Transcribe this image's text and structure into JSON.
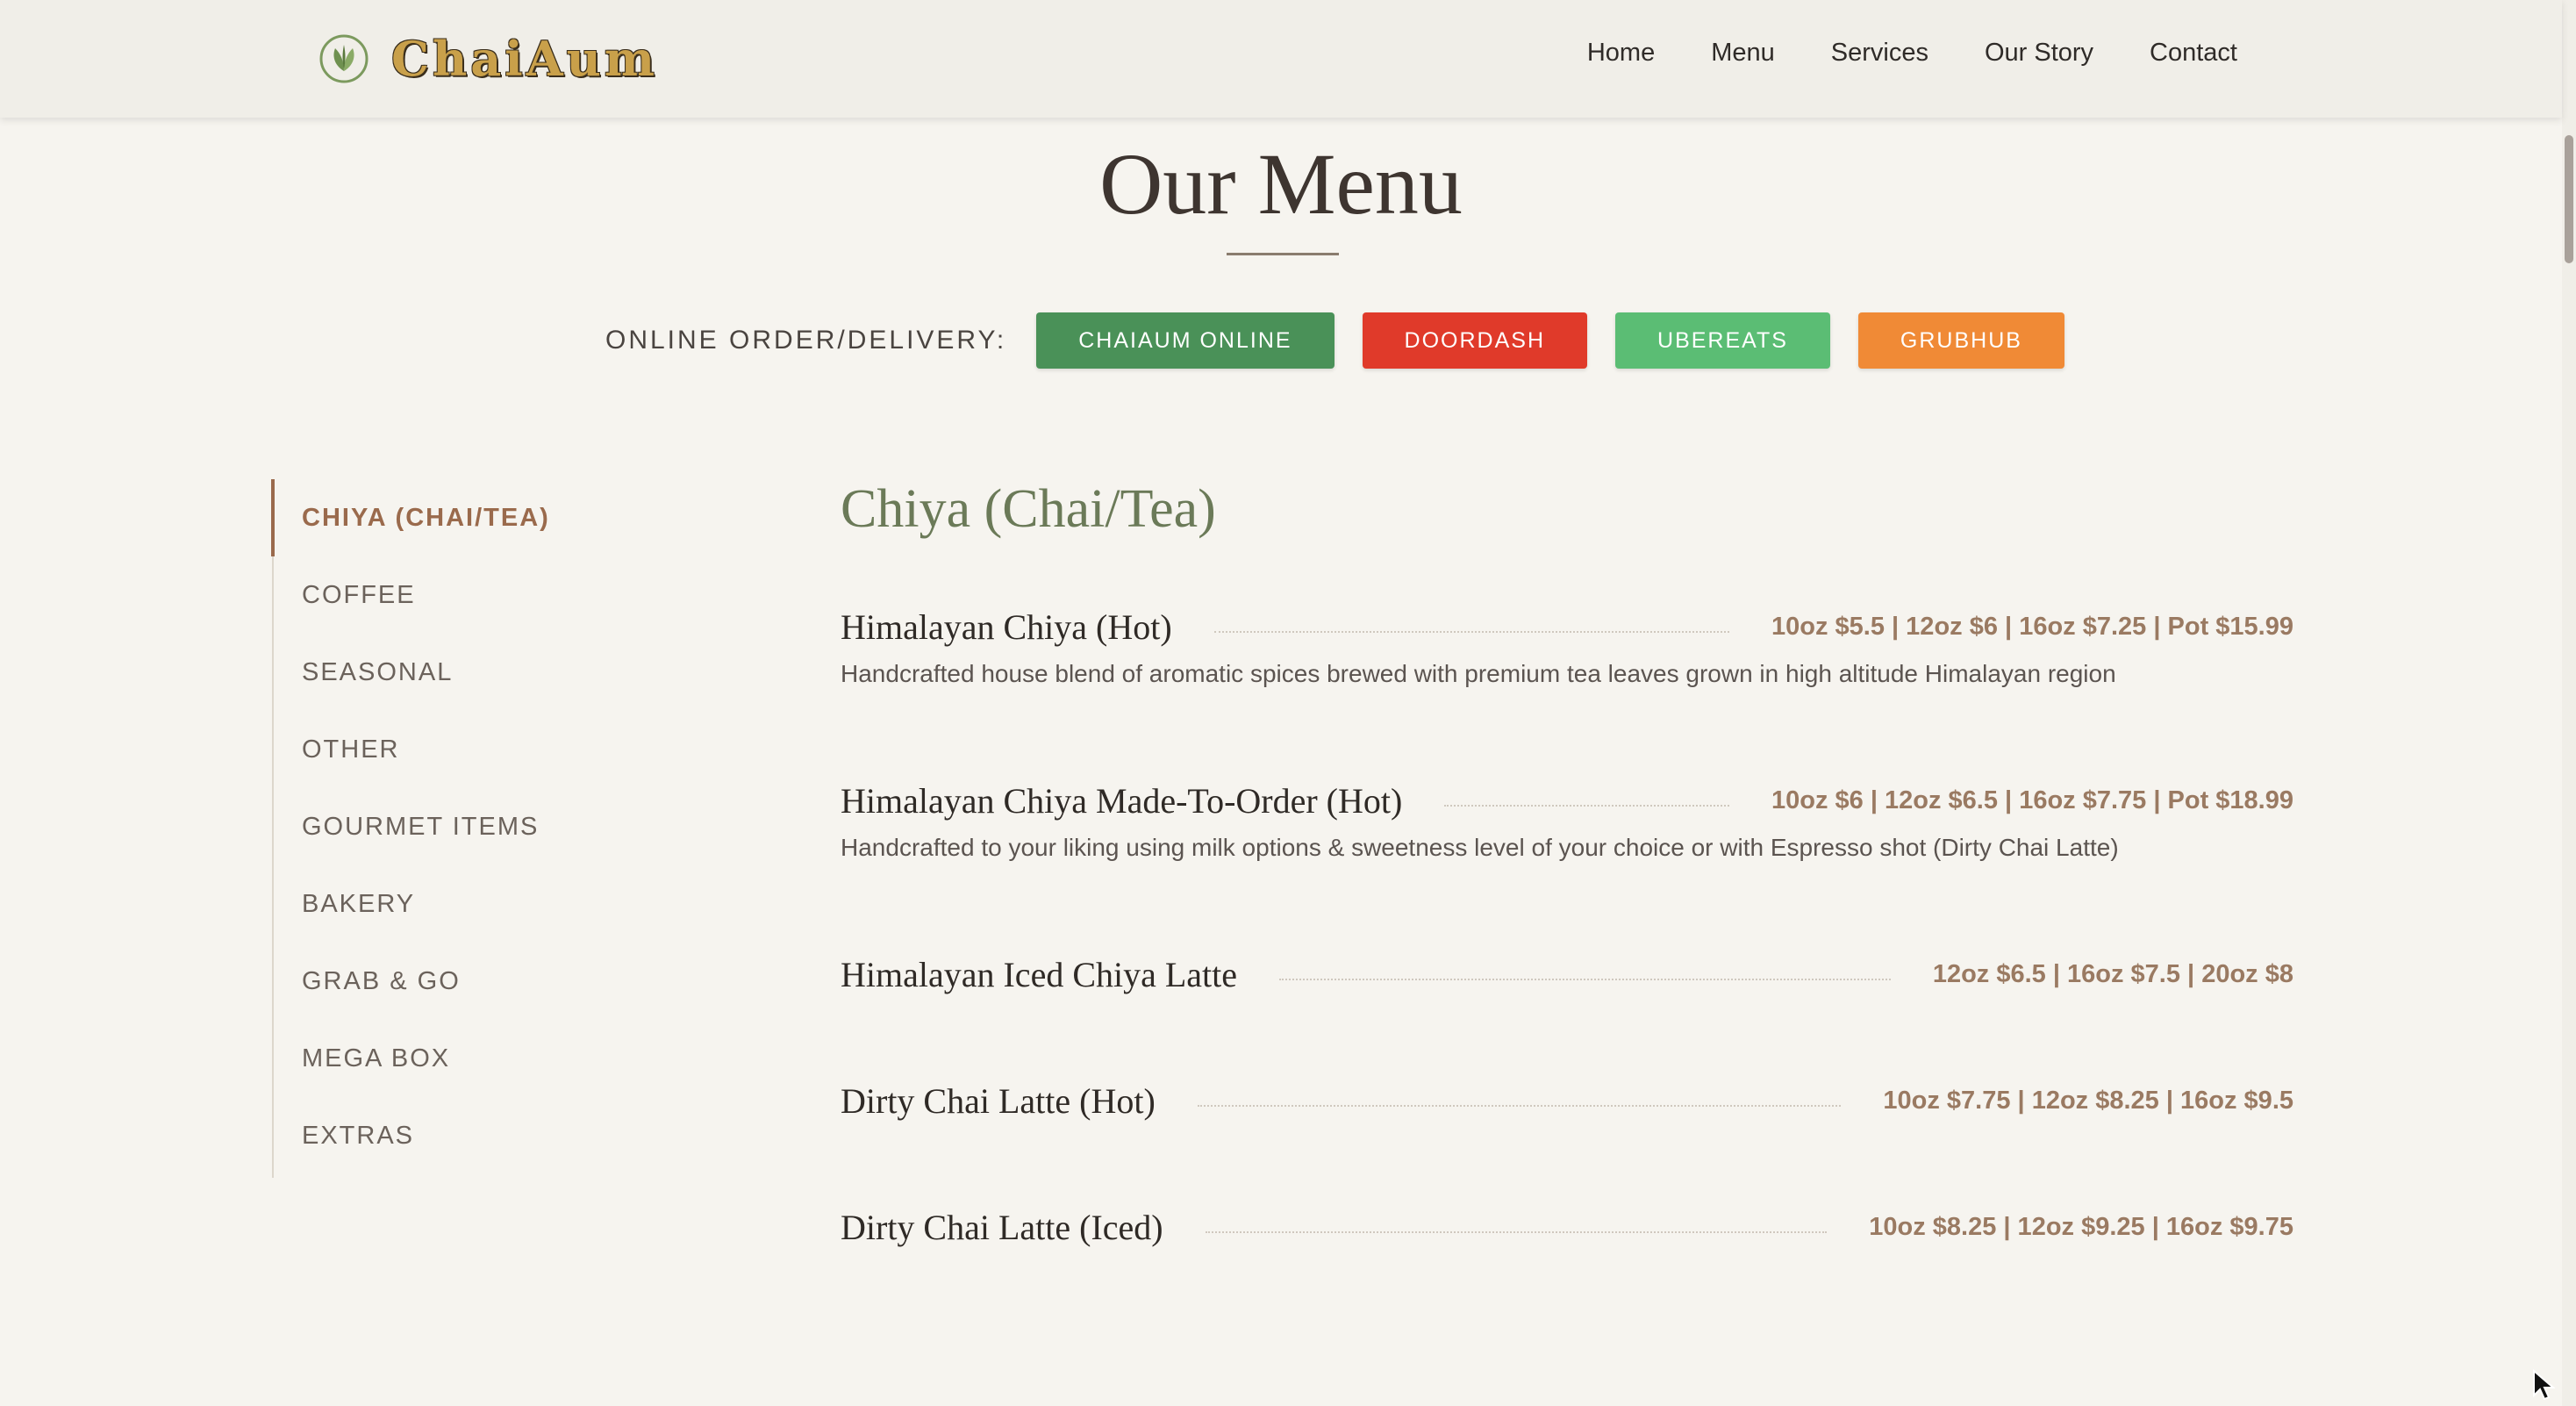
{
  "header": {
    "brand": "ChaiAum",
    "nav": [
      "Home",
      "Menu",
      "Services",
      "Our Story",
      "Contact"
    ]
  },
  "page": {
    "title": "Our Menu"
  },
  "order": {
    "label": "ONLINE ORDER/DELIVERY:",
    "buttons": [
      {
        "label": "CHAIAUM ONLINE",
        "color": "#4a9158"
      },
      {
        "label": "DOORDASH",
        "color": "#e03a2a"
      },
      {
        "label": "UBEREATS",
        "color": "#5bbd74"
      },
      {
        "label": "GRUBHUB",
        "color": "#f08a36"
      }
    ]
  },
  "sidebar": {
    "items": [
      "CHIYA (CHAI/TEA)",
      "COFFEE",
      "SEASONAL",
      "OTHER",
      "GOURMET ITEMS",
      "BAKERY",
      "GRAB & GO",
      "MEGA BOX",
      "EXTRAS"
    ],
    "active": "CHIYA (CHAI/TEA)"
  },
  "menu": {
    "section_title": "Chiya (Chai/Tea)",
    "items": [
      {
        "name": "Himalayan Chiya (Hot)",
        "price": "10oz $5.5 | 12oz $6 | 16oz $7.25 | Pot $15.99",
        "desc": "Handcrafted house blend of aromatic spices brewed with premium tea leaves grown in high altitude Himalayan region"
      },
      {
        "name": "Himalayan Chiya Made-To-Order (Hot)",
        "price": "10oz $6 | 12oz $6.5 | 16oz $7.75 | Pot $18.99",
        "desc": "Handcrafted to your liking using milk options & sweetness level of your choice or with Espresso shot (Dirty Chai Latte)"
      },
      {
        "name": "Himalayan Iced Chiya Latte",
        "price": "12oz $6.5 | 16oz $7.5 | 20oz $8",
        "desc": ""
      },
      {
        "name": "Dirty Chai Latte (Hot)",
        "price": "10oz $7.75 | 12oz $8.25 | 16oz $9.5",
        "desc": ""
      },
      {
        "name": "Dirty Chai Latte (Iced)",
        "price": "10oz $8.25 | 12oz $9.25 | 16oz $9.75",
        "desc": ""
      }
    ]
  },
  "colors": {
    "accent": "#9a6a4c",
    "section_title": "#6b7a58",
    "price": "#9a7a62",
    "background": "#f6f4ef"
  }
}
